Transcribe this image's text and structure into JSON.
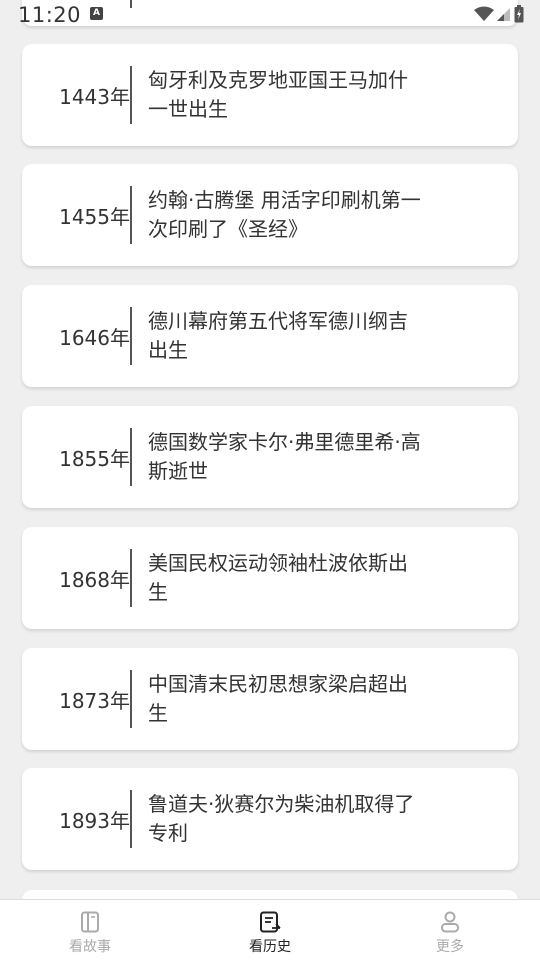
{
  "status_bar": {
    "time": "11:20",
    "notification_badge": "A",
    "icons": [
      "wifi-icon",
      "signal-icon",
      "battery-icon"
    ]
  },
  "events": [
    {
      "year": "1443年",
      "text": "匈牙利及克罗地亚国王马加什一世出生"
    },
    {
      "year": "1455年",
      "text": "约翰·古腾堡 用活字印刷机第一次印刷了《圣经》"
    },
    {
      "year": "1646年",
      "text": "德川幕府第五代将军德川纲吉出生"
    },
    {
      "year": "1855年",
      "text": "德国数学家卡尔·弗里德里希·高斯逝世"
    },
    {
      "year": "1868年",
      "text": "美国民权运动领袖杜波依斯出生"
    },
    {
      "year": "1873年",
      "text": "中国清末民初思想家梁启超出生"
    },
    {
      "year": "1893年",
      "text": "鲁道夫·狄赛尔为柴油机取得了专利"
    }
  ],
  "bottom_nav": {
    "items": [
      {
        "label": "看故事",
        "icon": "book-icon",
        "active": false
      },
      {
        "label": "看历史",
        "icon": "history-list-icon",
        "active": true
      },
      {
        "label": "更多",
        "icon": "person-icon",
        "active": false
      }
    ]
  },
  "colors": {
    "background": "#efefef",
    "card": "#ffffff",
    "text": "#333333",
    "nav_active": "#222222",
    "nav_inactive": "#aaaaaa"
  }
}
